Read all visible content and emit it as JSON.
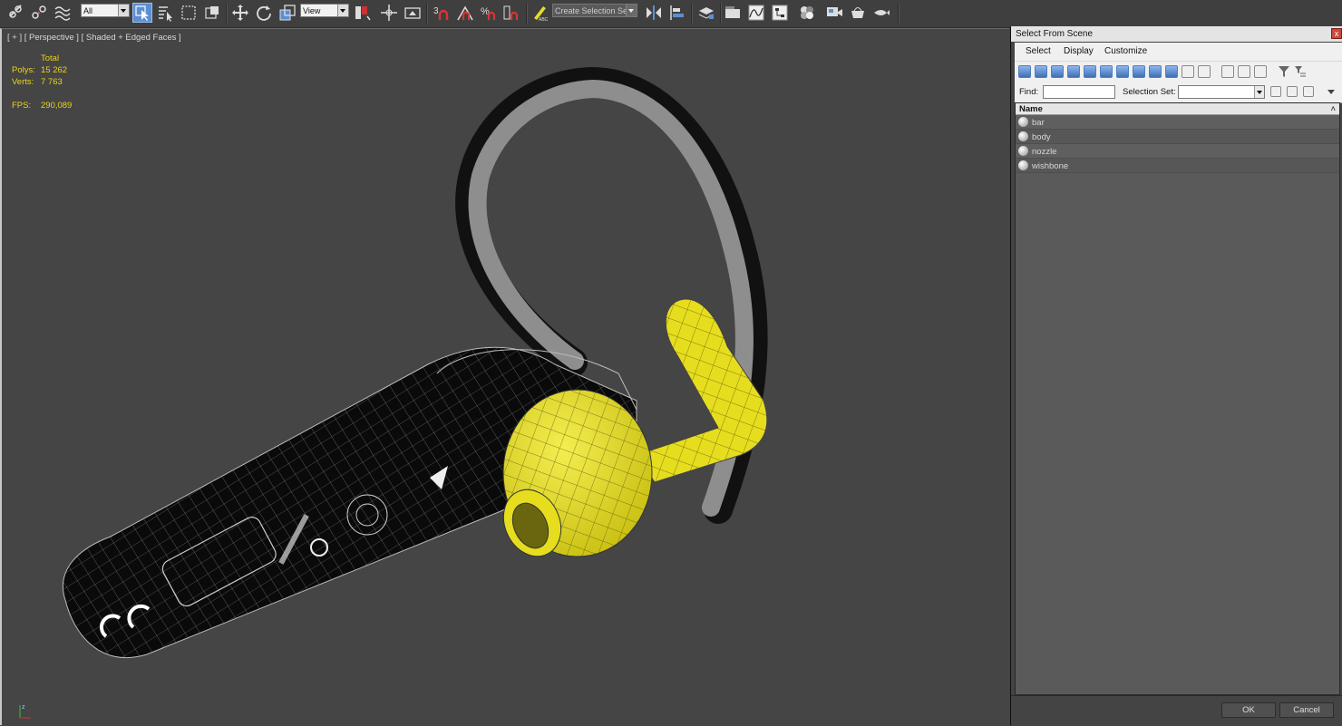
{
  "toolbar": {
    "selection_filter": "All",
    "reference_coord": "View",
    "named_selection_placeholder": "Create Selection Se",
    "snap_number": "3"
  },
  "viewport": {
    "label": "[ + ] [ Perspective ] [ Shaded + Edged Faces ]",
    "stats": {
      "total_label": "Total",
      "polys_label": "Polys:",
      "polys_value": "15 262",
      "verts_label": "Verts:",
      "verts_value": "7 763",
      "fps_label": "FPS:",
      "fps_value": "290,089"
    },
    "axis_label": "z"
  },
  "dialog": {
    "title": "Select From Scene",
    "close": "x",
    "menu": [
      "Select",
      "Display",
      "Customize"
    ],
    "find_label": "Find:",
    "selection_set_label": "Selection Set:",
    "list_header": "Name",
    "objects": [
      "bar",
      "body",
      "nozzle",
      "wishbone"
    ],
    "ok_label": "OK",
    "cancel_label": "Cancel"
  },
  "colors": {
    "accent_yellow": "#e6dd1e",
    "stats_yellow": "#e8d41a",
    "viewport_bg": "#454545",
    "toolbar_active": "#5b8fd4"
  }
}
